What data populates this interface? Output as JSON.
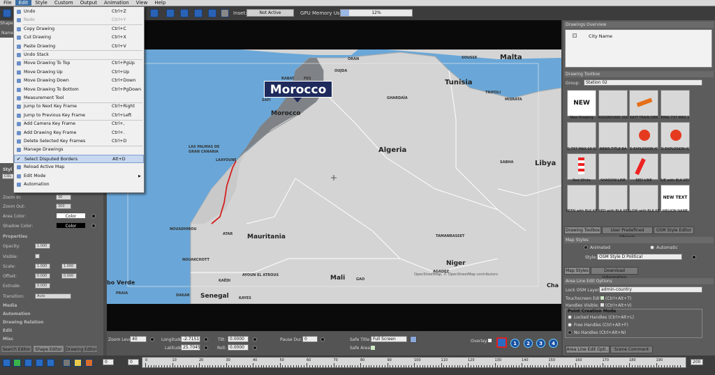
{
  "menubar": {
    "items": [
      "File",
      "Edit",
      "Style",
      "Custom",
      "Output",
      "Animation",
      "View",
      "Help"
    ]
  },
  "toolbar": {
    "inset_label": "Inset:",
    "inset_value": "Not Active",
    "gpu_label": "GPU Memory Usage:",
    "gpu_value": "12%",
    "gpu_fill_percent": 12
  },
  "edit_menu": {
    "items": [
      {
        "label": "Undo",
        "shortcut": "Ctrl+Z",
        "enabled": true
      },
      {
        "label": "Redo",
        "shortcut": "Ctrl+Y",
        "enabled": false
      },
      {
        "label": "Copy Drawing",
        "shortcut": "Ctrl+C",
        "enabled": true
      },
      {
        "label": "Cut Drawing",
        "shortcut": "Ctrl+X",
        "enabled": true
      },
      {
        "label": "Paste Drawing",
        "shortcut": "Ctrl+V",
        "enabled": true
      },
      {
        "label": "Undo Stack",
        "shortcut": "",
        "enabled": true
      },
      {
        "label": "Move Drawing To Top",
        "shortcut": "Ctrl+PgUp",
        "enabled": true
      },
      {
        "label": "Move Drawing Up",
        "shortcut": "Ctrl+Up",
        "enabled": true
      },
      {
        "label": "Move Drawing Down",
        "shortcut": "Ctrl+Down",
        "enabled": true
      },
      {
        "label": "Move Drawing To Bottom",
        "shortcut": "Ctrl+PgDown",
        "enabled": true
      },
      {
        "label": "Measurement Tool",
        "shortcut": "",
        "enabled": true
      },
      {
        "label": "Jump to Next Key Frame",
        "shortcut": "Ctrl+Right",
        "enabled": true
      },
      {
        "label": "Jump to Previous Key Frame",
        "shortcut": "Ctrl+Left",
        "enabled": true
      },
      {
        "label": "Add Camera Key Frame",
        "shortcut": "Ctrl+,",
        "enabled": true
      },
      {
        "label": "Add Drawing Key Frame",
        "shortcut": "Ctrl+.",
        "enabled": true
      },
      {
        "label": "Delete Selected Key Frames",
        "shortcut": "Ctrl+D",
        "enabled": true
      },
      {
        "label": "Manage Drawings",
        "shortcut": "",
        "enabled": true
      },
      {
        "label": "Select Disputed Borders",
        "shortcut": "Alt+D",
        "enabled": true,
        "checked": true
      },
      {
        "label": "Reload Active Map",
        "shortcut": "",
        "enabled": true
      },
      {
        "label": "Edit Mode",
        "shortcut": "",
        "enabled": true,
        "submenu": true
      },
      {
        "label": "Automation",
        "shortcut": "",
        "enabled": true
      }
    ]
  },
  "left_panel": {
    "shape_tab": "Shape",
    "name_col": "Name",
    "style_tab": "Styl",
    "cols_label": "COL",
    "zoom_in_label": "Zoom In:",
    "zoom_in_value": "30",
    "zoom_out_label": "Zoom Out:",
    "zoom_out_value": "300",
    "area_color_label": "Area Color:",
    "area_color_btn": "Color",
    "shadow_color_label": "Shadow Color:",
    "shadow_color_btn": "Color",
    "properties": "Properties",
    "opacity_label": "Opacity:",
    "opacity_value": "1.000",
    "visible_label": "Visible:",
    "scale_label": "Scale:",
    "scale_x": "1.000",
    "scale_y": "1.000",
    "offset_label": "Offset:",
    "offset_x": "0.000",
    "offset_y": "0.000",
    "extrude_label": "Extrude:",
    "extrude_value": "0.000",
    "transition_label": "Transition:",
    "transition_value": "Auto",
    "sections": [
      "Media",
      "Automation",
      "Drawing Relation",
      "Edit",
      "Misc"
    ],
    "bottom_tabs": [
      "Search Editor",
      "Shape Editor",
      "Drawing Editor"
    ]
  },
  "map": {
    "callout": "Morocco",
    "labels": {
      "malta": "Malta",
      "tunisia": "Tunisia",
      "algeria": "Algeria",
      "libya": "Libya",
      "morocco": "Morocco",
      "mauritania": "Mauritania",
      "mali": "Mali",
      "niger": "Niger",
      "senegal": "Senegal",
      "bo_verde": "bo Verde",
      "chad": "Cha",
      "oran": "ORAN",
      "rabat": "RABAT",
      "fes": "FES",
      "oujda": "OUJDA",
      "safi": "SAFI",
      "ghardaia": "GHARDAÏA",
      "tripoli": "TRIPOLI",
      "misrata": "MISRATA",
      "sousse": "SOUSSE",
      "las_palmas": "LAS PALMAS DE\nGRAN CANARIA",
      "laayoune": "LAAYOUNE",
      "sabha": "SABHA",
      "nouadhibou": "NOUADHIBOU",
      "atar": "ATAR",
      "nouakchott": "NOUAKCHOTT",
      "tamanrasset": "TAMANRASSET",
      "agadez": "AGADEZ",
      "kaedi": "KAËDI",
      "ayoun": "AYOUN EL ATROUS",
      "gao": "GAO",
      "dakar": "DAKAR",
      "kayes": "KAYES",
      "praia": "PRAIA"
    },
    "copyright": "OpenStreetMap, © OpenStreetMap contributors"
  },
  "bottom_bar": {
    "zoom_label": "Zoom Level:",
    "zoom_value": "40",
    "longitude_label": "Longitude:",
    "longitude_value": "-2.7151",
    "latitude_label": "Latitude:",
    "latitude_value": "25.7045",
    "tilt_label": "Tilt:",
    "tilt_value": "0.0000",
    "roll_label": "Roll:",
    "roll_value": "0.0000",
    "pause_label": "Pause Dur.:",
    "pause_value": "0",
    "safe_title_label": "Safe Title:",
    "safe_title_value": "Full Screen",
    "safe_area_label": "Safe Area:",
    "overlay_label": "Overlay:",
    "presets": [
      "1",
      "2",
      "3",
      "4"
    ]
  },
  "right_panel": {
    "overview_title": "Drawings Overview",
    "overview_item": "City Name",
    "toolbox_title": "Drawing Toolbox",
    "group_label": "Group:",
    "group_value": "Station 02",
    "tiles": [
      "New Drawing",
      "ACKGROUND 200",
      "IGHT TRAIN DER",
      "EING 737 MAX 1",
      "G 737 MAX 10 SI",
      "NEWS TITLE BA",
      "D EXPLOSION IC",
      "D EXPLOSION IC",
      "Red White",
      "SHADOW LINE",
      "RED LINE",
      "IUE with BLK KEY",
      "REEN with BLK KE",
      "RED with BLK KE",
      "LLOW with BLK KE",
      "REGION NAME"
    ],
    "new_tile_text": "NEW",
    "new_text_tile": "NEW TEXT",
    "tabs_a": [
      "Drawing Toolbox",
      "User Predefined Objects",
      "OSM Style Editor"
    ],
    "map_styles_title": "Map Styles",
    "animated": "Animated",
    "automatic": "Automatic",
    "style_label": "Style:",
    "style_value": "OSM Style D Political",
    "tabs_b": [
      "Map Styles",
      "Download Information"
    ],
    "area_line_title": "Area Line Edit Options",
    "lock_label": "Lock OSM Layer:",
    "lock_value": "admin-country",
    "touch_label": "Touchscreen Edit:",
    "touch_value": "(Ctrl+Alt+T)",
    "handles_label": "Handles Visible:",
    "handles_value": "(Ctrl+Alt+V)",
    "pcm_title": "Point Creation Mode",
    "pcm_options": [
      "Locked Handles (Ctrl+Alt+L)",
      "Free Handles (Ctrl+Alt+F)",
      "No Handles (Ctrl+Alt+N)"
    ],
    "tabs_c": [
      "Area Line Edit Opti..",
      "Scene Comment"
    ]
  },
  "timeline": {
    "start": "0",
    "current": "0",
    "end": "200",
    "ticks": [
      "0",
      "10",
      "20",
      "30",
      "40",
      "50",
      "60",
      "70",
      "80",
      "90",
      "100",
      "110",
      "120",
      "130",
      "140",
      "150",
      "160",
      "170",
      "180",
      "190"
    ]
  },
  "colors": {
    "accent": "#3b6ea5",
    "water": "#6aa7d8",
    "land": "#d4d4d4",
    "morocco": "#7f8387",
    "border_red": "#d42020",
    "callout_bg": "#1e2a5c"
  }
}
